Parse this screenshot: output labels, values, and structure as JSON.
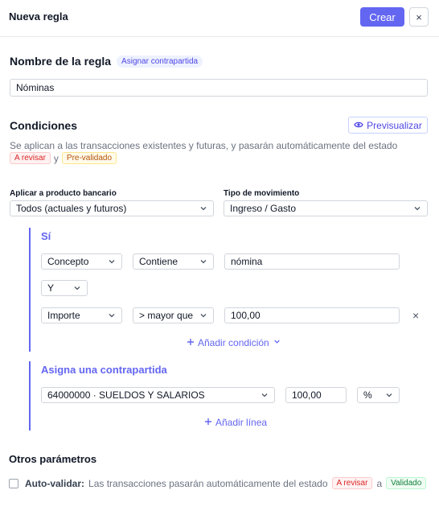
{
  "header": {
    "title": "Nueva regla",
    "create_label": "Crear",
    "close_label": "×"
  },
  "rule": {
    "section_title": "Nombre de la regla",
    "badge": "Asignar contrapartida",
    "name_value": "Nóminas"
  },
  "conditions": {
    "section_title": "Condiciones",
    "preview_label": "Previsualizar",
    "description": "Se aplican a las transacciones existentes y futuras, y pasarán automáticamente del estado",
    "status_from": "A revisar",
    "connector": "y",
    "status_to": "Pre-validado",
    "bank_label": "Aplicar a producto bancario",
    "bank_value": "Todos (actuales y futuros)",
    "movement_label": "Tipo de movimiento",
    "movement_value": "Ingreso / Gasto",
    "if_label": "Sí",
    "rows": [
      {
        "field": "Concepto",
        "operator": "Contiene",
        "value": "nómina"
      },
      {
        "field": "Importe",
        "operator": "> mayor que",
        "value": "100,00"
      }
    ],
    "logic_value": "Y",
    "remove_label": "×",
    "add_condition_label": "Añadir condición"
  },
  "assign": {
    "title": "Asigna una contrapartida",
    "account_value": "64000000 · SUELDOS Y SALARIOS",
    "amount_value": "100,00",
    "unit_value": "%",
    "add_line_label": "Añadir línea"
  },
  "other": {
    "section_title": "Otros parámetros",
    "autovalidate_label": "Auto-validar:",
    "autovalidate_text": "Las transacciones pasarán automáticamente del estado",
    "status_from": "A revisar",
    "connector": "a",
    "status_to": "Validado",
    "checked": false
  },
  "colors": {
    "accent": "#6366f1",
    "danger": "#dc2626",
    "warning": "#b45309",
    "success": "#15803d"
  }
}
